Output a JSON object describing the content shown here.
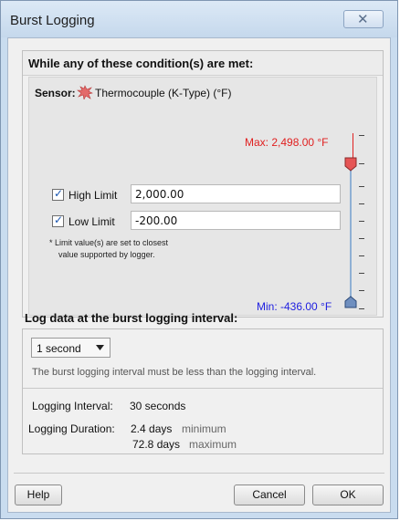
{
  "window": {
    "title": "Burst Logging",
    "close_glyph": "✕"
  },
  "conditions": {
    "header": "While any of these condition(s) are met:",
    "sensor_label": "Sensor:",
    "sensor_name": "Thermocouple (K-Type) (°F)",
    "sensor_icon": "thermocouple-icon",
    "max_label": "Max: 2,498.00 °F",
    "min_label": "Min: -436.00 °F",
    "high_limit": {
      "label": "High Limit",
      "checked": true,
      "value": "2,000.00"
    },
    "low_limit": {
      "label": "Low Limit",
      "checked": true,
      "value": "-200.00"
    },
    "note_line1": "*  Limit value(s) are set to closest",
    "note_line2": "value supported by logger.",
    "colors": {
      "max": "#e02020",
      "min": "#2020e0"
    }
  },
  "interval": {
    "header": "Log data at the burst logging interval:",
    "selected": "1 second",
    "hint": "The burst logging interval must be less than the logging interval.",
    "logging_interval_label": "Logging Interval:",
    "logging_interval_value": "30 seconds",
    "logging_duration_label": "Logging Duration:",
    "duration_min_value": "2.4 days",
    "duration_min_word": "minimum",
    "duration_max_value": "72.8 days",
    "duration_max_word": "maximum"
  },
  "buttons": {
    "help": "Help",
    "cancel": "Cancel",
    "ok": "OK"
  }
}
